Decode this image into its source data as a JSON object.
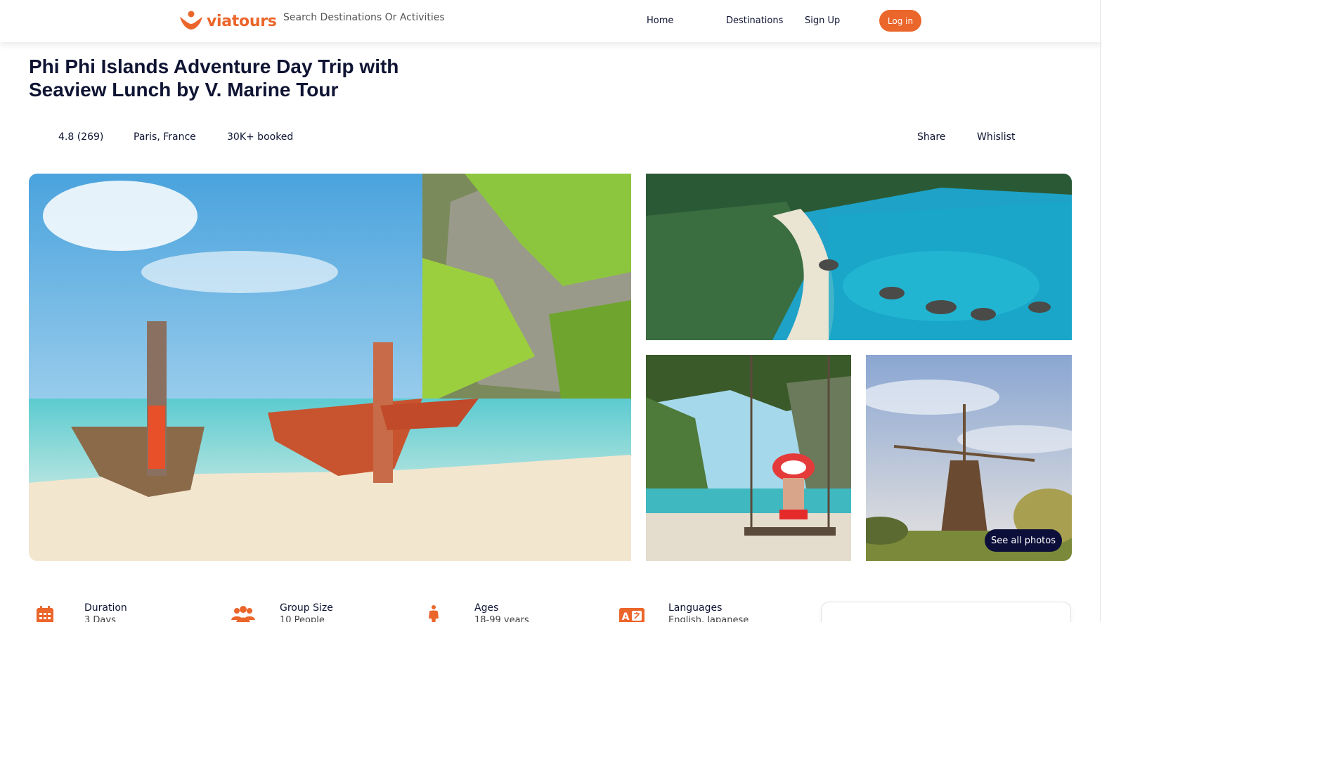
{
  "header": {
    "logo_text": "viatours",
    "search_placeholder": "Search Destinations Or Activities",
    "nav": {
      "home": "Home",
      "destinations": "Destinations",
      "signup": "Sign Up",
      "login": "Log in"
    }
  },
  "tour": {
    "title": "Phi Phi Islands Adventure Day Trip with Seaview Lunch by V. Marine Tour",
    "rating": "4.8 (269)",
    "location": "Paris, France",
    "booked": "30K+ booked",
    "share": "Share",
    "wishlist": "Whislist"
  },
  "gallery": {
    "see_all": "See all photos"
  },
  "info": [
    {
      "label": "Duration",
      "value": "3 Days",
      "icon": "calendar-icon"
    },
    {
      "label": "Group Size",
      "value": "10 People",
      "icon": "group-icon"
    },
    {
      "label": "Ages",
      "value": "18-99 years",
      "icon": "person-icon"
    },
    {
      "label": "Languages",
      "value": "English, Japanese",
      "icon": "translate-icon"
    }
  ],
  "colors": {
    "accent": "#eb662b",
    "dark_navy": "#0f1433",
    "badge_bg": "#0c0f3a"
  }
}
